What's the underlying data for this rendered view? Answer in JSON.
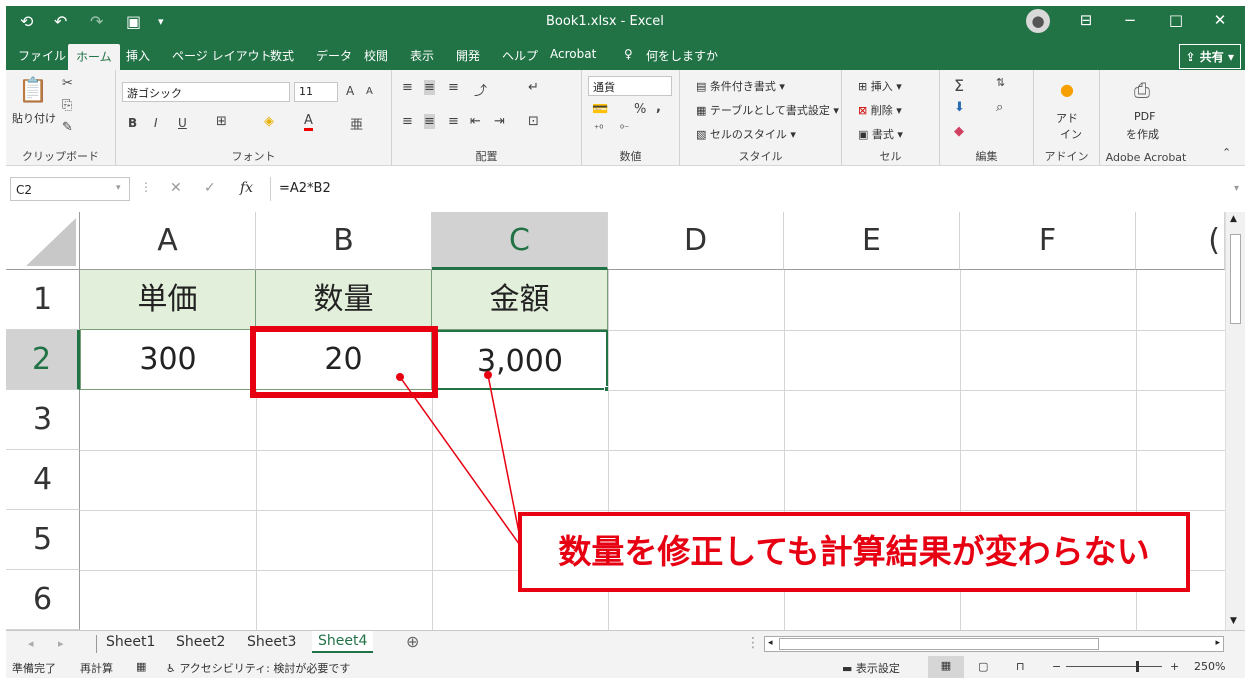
{
  "titlebar": {
    "title": "Book1.xlsx  -  Excel",
    "minimize": "−",
    "maximize": "□",
    "close": "✕"
  },
  "tabs": [
    "ファイル",
    "ホーム",
    "挿入",
    "ページ レイアウト",
    "数式",
    "データ",
    "校閲",
    "表示",
    "開発",
    "ヘルプ",
    "Acrobat"
  ],
  "tell_me": "何をしますか",
  "share_label": "共有",
  "ribbon": {
    "clipboard": {
      "label": "クリップボード",
      "paste": "貼り付け"
    },
    "font": {
      "label": "フォント",
      "name": "游ゴシック",
      "size": "11",
      "bold": "B",
      "italic": "I",
      "underline": "U",
      "grow": "A",
      "shrink": "A",
      "color": "A"
    },
    "alignment": {
      "label": "配置"
    },
    "number": {
      "label": "数値",
      "format": "通貨",
      "percent": "%",
      "comma": ","
    },
    "styles": {
      "label": "スタイル",
      "conditional": "条件付き書式",
      "table": "テーブルとして書式設定",
      "cell_styles": "セルのスタイル"
    },
    "cells": {
      "label": "セル",
      "insert": "挿入",
      "delete": "削除",
      "format": "書式"
    },
    "editing": {
      "label": "編集",
      "sum": "Σ"
    },
    "addins": {
      "label": "アドイン",
      "line1": "アド",
      "line2": "イン"
    },
    "acrobat": {
      "label": "Adobe Acrobat",
      "line1": "PDF",
      "line2": "を作成"
    }
  },
  "formula_bar": {
    "name_box": "C2",
    "formula": "=A2*B2",
    "fx": "fx",
    "cancel": "✕",
    "enter": "✓"
  },
  "columns": [
    "A",
    "B",
    "C",
    "D",
    "E",
    "F",
    "("
  ],
  "rows": [
    "1",
    "2",
    "3",
    "4",
    "5",
    "6"
  ],
  "cells": {
    "A1": "単価",
    "B1": "数量",
    "C1": "金額",
    "A2": "300",
    "B2": "20",
    "C2": "3,000"
  },
  "sheets": [
    "Sheet1",
    "Sheet2",
    "Sheet3",
    "Sheet4"
  ],
  "status": {
    "ready": "準備完了",
    "recalc": "再計算",
    "accessibility": "アクセシビリティ: 検討が必要です",
    "display_settings": "表示設定",
    "zoom": "250%",
    "minus": "−",
    "plus": "+"
  },
  "callout": {
    "text": "数量を修正しても計算結果が変わらない"
  },
  "colors": {
    "excel_green": "#217346",
    "annotation_red": "#e60012",
    "header_fill": "#e2efda"
  }
}
